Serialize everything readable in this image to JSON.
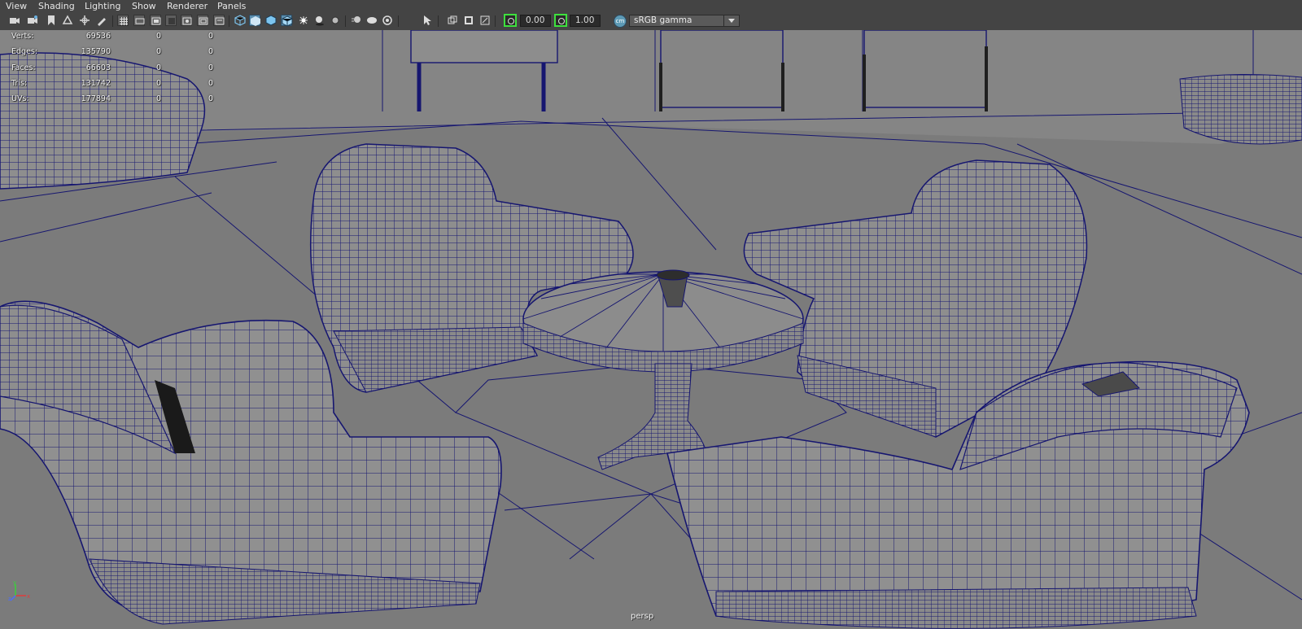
{
  "menu": [
    "View",
    "Shading",
    "Lighting",
    "Show",
    "Renderer",
    "Panels"
  ],
  "toolbar": {
    "icons": [
      "camera-icon",
      "camera-attributes-icon",
      "bookmark-icon",
      "image-plane-icon",
      "2d-pan-zoom-icon",
      "grease-pencil-icon",
      "grid-icon",
      "film-gate-icon",
      "resolution-gate-icon",
      "gate-mask-icon",
      "field-chart-icon",
      "safe-action-icon",
      "safe-title-icon",
      "wireframe-icon",
      "smooth-shade-icon",
      "wireframe-on-shaded-icon",
      "textured-icon",
      "use-all-lights-icon",
      "shadows-icon",
      "screen-space-ao-icon",
      "motion-blur-icon",
      "anti-aliasing-icon",
      "depth-of-field-icon",
      "isolate-select-icon",
      "xray-icon",
      "xray-joints-icon",
      "xray-active-icon",
      "backface-culling-icon"
    ],
    "exposure": "0.00",
    "gamma": "1.00",
    "color_management_badge": "cm",
    "view_transform": "sRGB gamma"
  },
  "hud": {
    "rows": [
      {
        "label": "Verts:",
        "v1": "69536",
        "v2": "0",
        "v3": "0"
      },
      {
        "label": "Edges:",
        "v1": "135790",
        "v2": "0",
        "v3": "0"
      },
      {
        "label": "Faces:",
        "v1": "66603",
        "v2": "0",
        "v3": "0"
      },
      {
        "label": "Tris:",
        "v1": "131742",
        "v2": "0",
        "v3": "0"
      },
      {
        "label": "UVs:",
        "v1": "177894",
        "v2": "0",
        "v3": "0"
      }
    ]
  },
  "axis": {
    "x": "x",
    "y": "y",
    "z": "z",
    "colors": {
      "x": "#e23b3b",
      "y": "#3bd13b",
      "z": "#4a6cff"
    }
  },
  "camera_name": "persp",
  "colors": {
    "wire": "#161670",
    "surface": "#8d8d8d",
    "background": "#7a7a7a",
    "toolbar_bg": "#444444",
    "active_icon": "#5c8fb0",
    "exposure_highlight": "#3de03d"
  }
}
